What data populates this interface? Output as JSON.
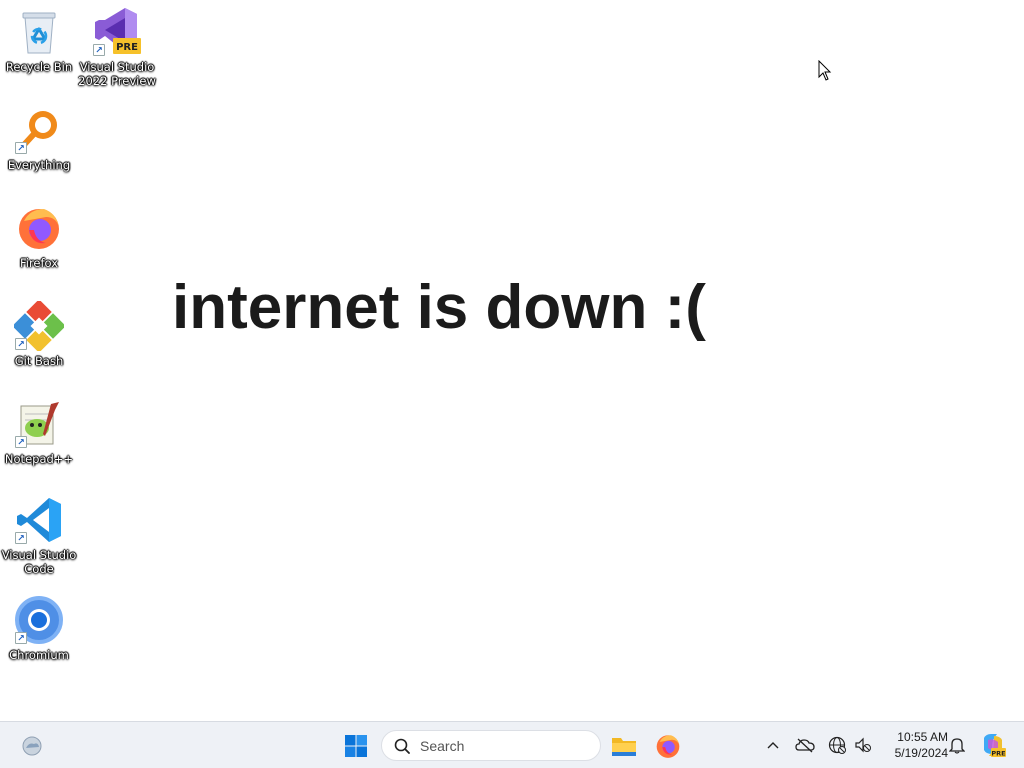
{
  "desktop": {
    "icons": [
      {
        "label": "Recycle Bin",
        "icon": "recycle-bin-icon"
      },
      {
        "label": "Visual Studio 2022 Preview",
        "icon": "visual-studio-preview-icon",
        "badge": "PRE"
      },
      {
        "label": "Everything",
        "icon": "everything-search-icon"
      },
      {
        "label": "Firefox",
        "icon": "firefox-icon"
      },
      {
        "label": "Git Bash",
        "icon": "git-bash-icon"
      },
      {
        "label": "Notepad++",
        "icon": "notepad-plus-plus-icon"
      },
      {
        "label": "Visual Studio Code",
        "icon": "vscode-icon"
      },
      {
        "label": "Chromium",
        "icon": "chromium-icon"
      }
    ],
    "headline": "internet is down :("
  },
  "taskbar": {
    "widgets_icon": "weather-widget-icon",
    "start_icon": "windows-start-icon",
    "search": {
      "placeholder": "Search",
      "icon": "search-icon"
    },
    "pinned": [
      {
        "name": "File Explorer",
        "icon": "file-explorer-icon"
      },
      {
        "name": "Firefox",
        "icon": "firefox-icon"
      }
    ],
    "tray": {
      "icons": [
        "chevron-up-icon",
        "onedrive-offline-icon",
        "network-globe-icon",
        "sound-muted-icon"
      ],
      "time": "10:55 AM",
      "date": "5/19/2024",
      "notification_icon": "bell-icon",
      "copilot_icon": "copilot-preview-icon"
    }
  },
  "colors": {
    "desktop_bg": "#ffffff",
    "taskbar_bg": "#eef1f6",
    "headline": "#1b1b1b",
    "windows_blue": "#0a74d9"
  }
}
